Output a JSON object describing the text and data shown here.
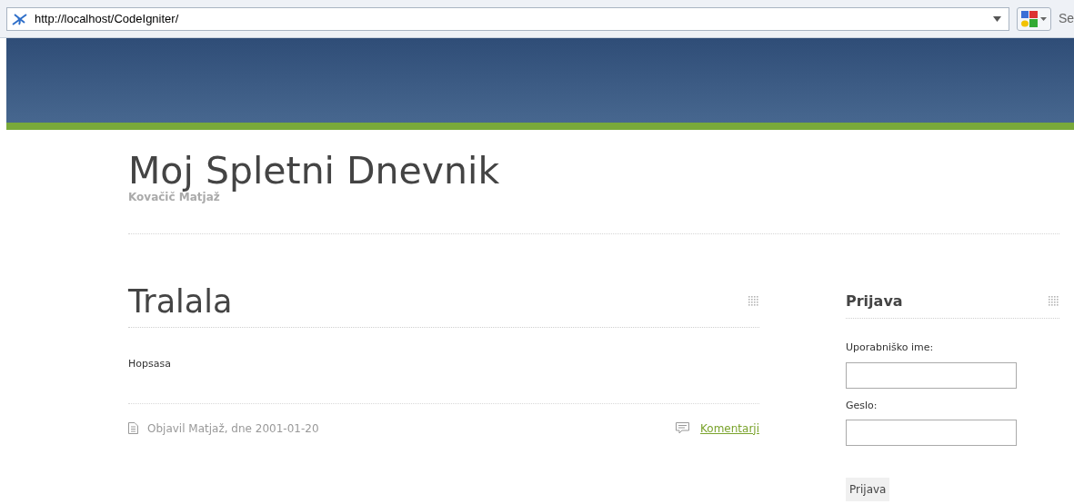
{
  "browser": {
    "url": "http://localhost/CodeIgniter/",
    "search_placeholder": "Se"
  },
  "site": {
    "title": "Moj Spletni Dnevnik",
    "subtitle": "Kovačič Matjaž"
  },
  "post": {
    "title": "Tralala",
    "body": "Hopsasa",
    "meta": "Objavil Matjaž, dne 2001-01-20",
    "comments_link": "Komentarji"
  },
  "sidebar": {
    "title": "Prijava",
    "fields": [
      {
        "label": "Uporabniško ime:"
      },
      {
        "label": "Geslo:"
      }
    ],
    "button": "Prijava"
  }
}
